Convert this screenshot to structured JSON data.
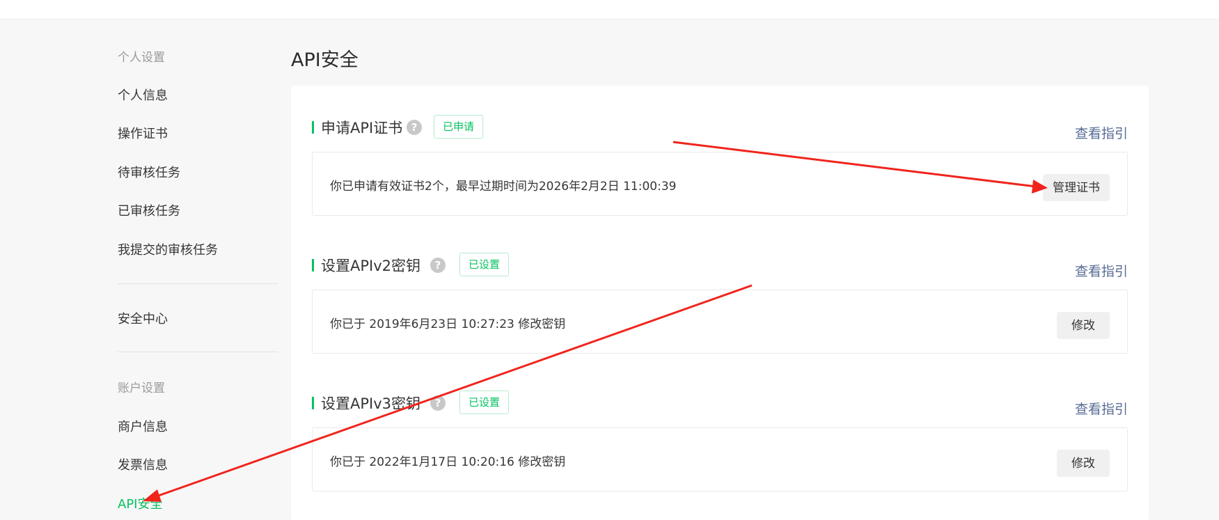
{
  "sidebar": {
    "group_personal": "个人设置",
    "personal_items": [
      {
        "label": "个人信息"
      },
      {
        "label": "操作证书"
      },
      {
        "label": "待审核任务"
      },
      {
        "label": "已审核任务"
      },
      {
        "label": "我提交的审核任务"
      }
    ],
    "security_center": "安全中心",
    "group_account": "账户设置",
    "account_items": [
      {
        "label": "商户信息"
      },
      {
        "label": "发票信息"
      },
      {
        "label": "API安全",
        "active": true
      }
    ]
  },
  "main": {
    "title": "API安全",
    "sections": [
      {
        "title": "申请API证书",
        "badge": "已申请",
        "guide": "查看指引",
        "text": "你已申请有效证书2个，最早过期时间为2026年2月2日 11:00:39",
        "button": "管理证书"
      },
      {
        "title": "设置APIv2密钥",
        "badge": "已设置",
        "guide": "查看指引",
        "text": "你已于 2019年6月23日 10:27:23 修改密钥",
        "button": "修改"
      },
      {
        "title": "设置APIv3密钥",
        "badge": "已设置",
        "guide": "查看指引",
        "text": "你已于 2022年1月17日 10:20:16 修改密钥",
        "button": "修改"
      }
    ]
  },
  "icons": {
    "help": "?"
  },
  "colors": {
    "accent": "#07c160",
    "link": "#576b95",
    "annotation": "#f0241c"
  }
}
